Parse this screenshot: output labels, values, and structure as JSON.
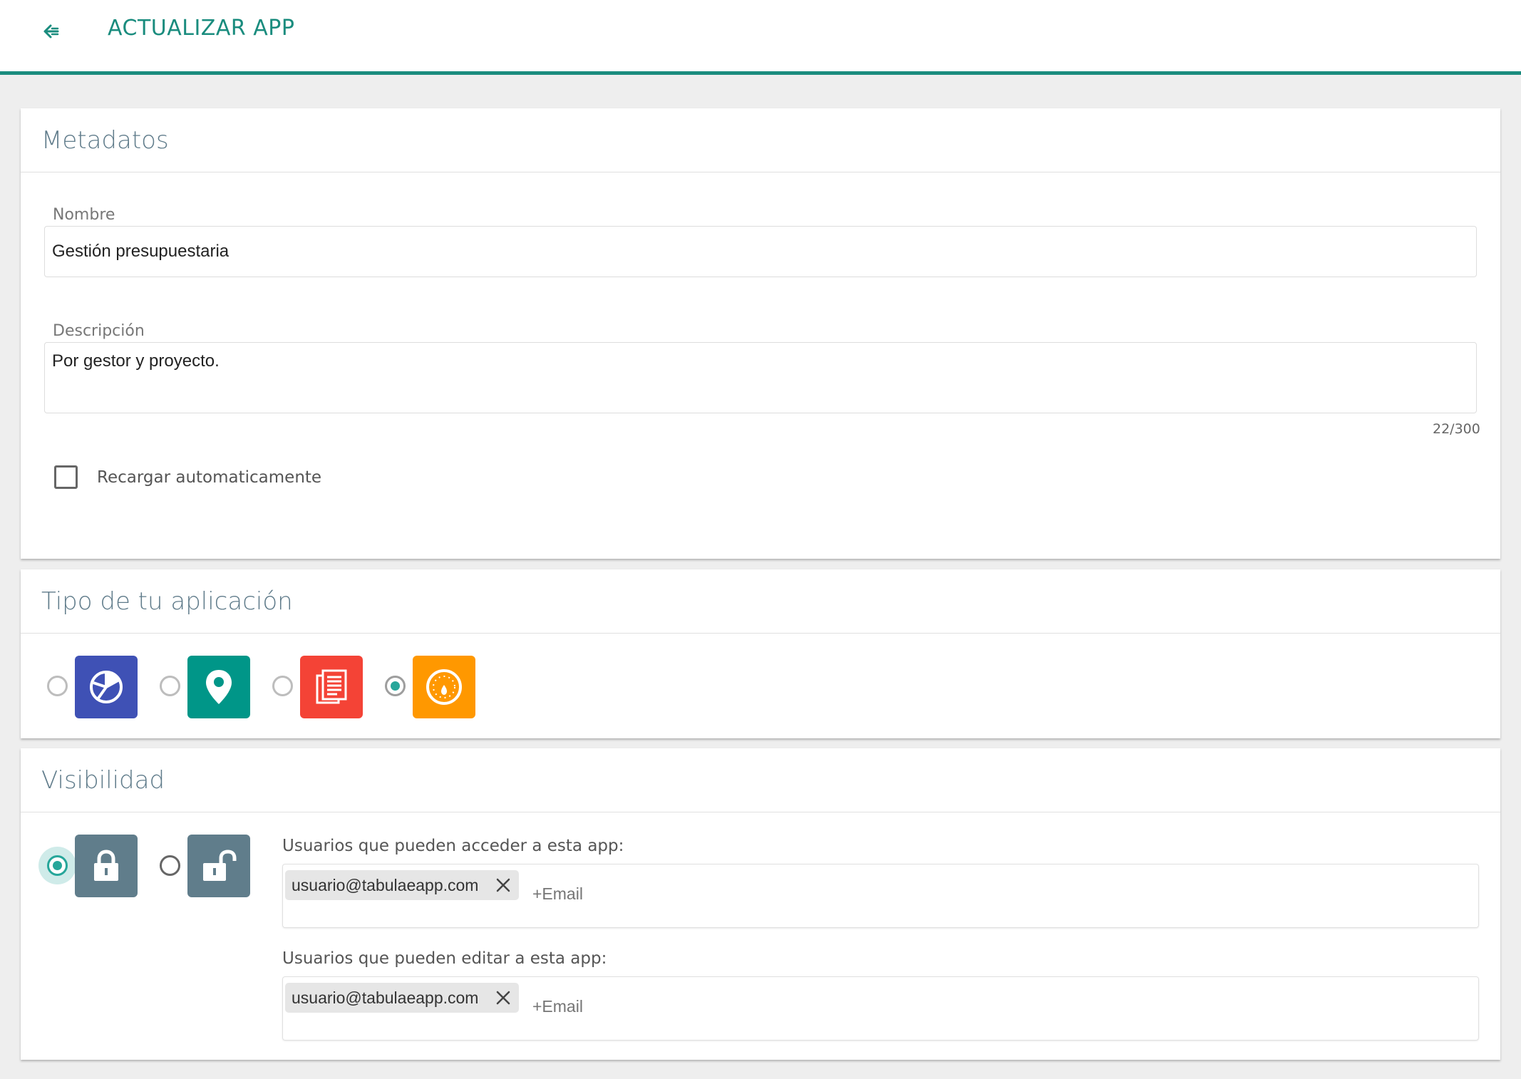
{
  "header": {
    "title": "ACTUALIZAR APP"
  },
  "metadata": {
    "title": "Metadatos",
    "name_label": "Nombre",
    "name_value": "Gestión presupuestaria",
    "description_label": "Descripción",
    "description_value": "Por gestor y proyecto.",
    "description_counter": "22/300",
    "autoreload_label": "Recargar automaticamente"
  },
  "app_type": {
    "title": "Tipo de tu aplicación",
    "options": [
      {
        "icon": "pie-chart-icon",
        "color": "#3f51b5",
        "selected": false
      },
      {
        "icon": "map-pin-icon",
        "color": "#009688",
        "selected": false
      },
      {
        "icon": "document-icon",
        "color": "#f44336",
        "selected": false
      },
      {
        "icon": "gauge-icon",
        "color": "#ff9800",
        "selected": true
      }
    ]
  },
  "visibility": {
    "title": "Visibilidad",
    "options": [
      {
        "icon": "lock-closed-icon",
        "selected": true
      },
      {
        "icon": "lock-open-icon",
        "selected": false
      }
    ],
    "access_label": "Usuarios que pueden acceder a esta app:",
    "access_users": [
      "usuario@tabulaeapp.com"
    ],
    "access_placeholder": "+Email",
    "edit_label": "Usuarios que pueden editar a esta app:",
    "edit_users": [
      "usuario@tabulaeapp.com"
    ],
    "edit_placeholder": "+Email"
  },
  "colors": {
    "accent": "#1a8c7e",
    "radio_selected": "#26a69a",
    "card_title": "#5f7b8a",
    "visibility_tile": "#607d8b"
  }
}
